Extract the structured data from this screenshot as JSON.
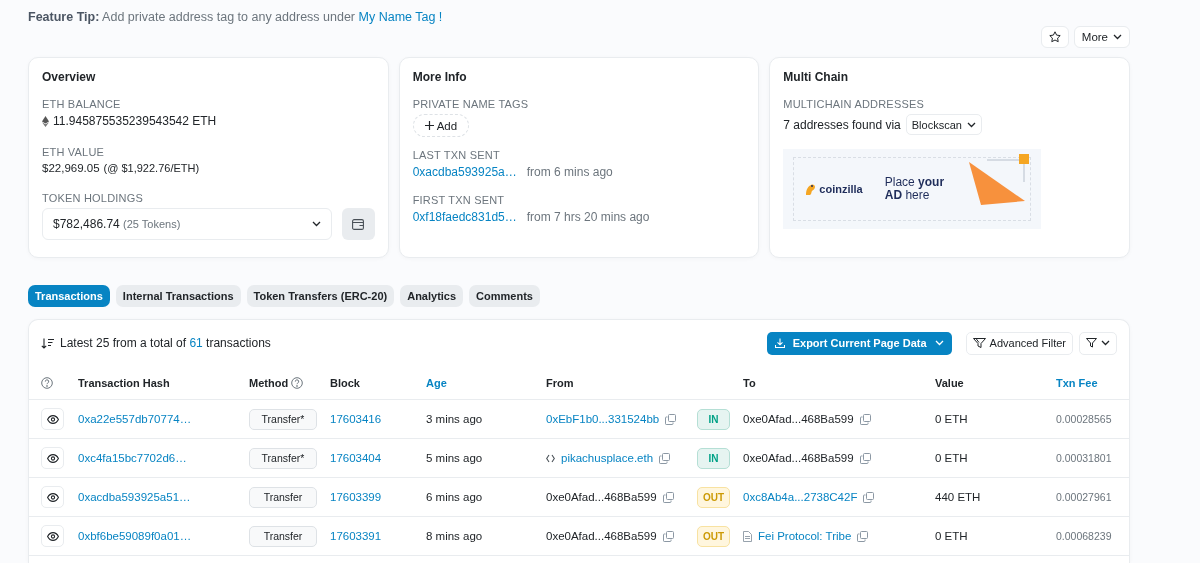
{
  "feature_tip": {
    "label": "Feature Tip:",
    "text": "Add private address tag to any address under",
    "link": "My Name Tag !"
  },
  "actions": {
    "more": "More"
  },
  "overview": {
    "title": "Overview",
    "eth_balance": {
      "label": "ETH BALANCE",
      "value": "11.945875535239543542 ETH"
    },
    "eth_value": {
      "label": "ETH VALUE",
      "value": "$22,969.05",
      "rate": "(@ $1,922.76/ETH)"
    },
    "token_holdings": {
      "label": "TOKEN HOLDINGS",
      "value": "$782,486.74",
      "count": "(25 Tokens)"
    }
  },
  "more_info": {
    "title": "More Info",
    "private_name_tags": {
      "label": "PRIVATE NAME TAGS",
      "button": "Add"
    },
    "last_txn_sent": {
      "label": "LAST TXN SENT",
      "hash": "0xacdba593925a…",
      "age": "from 6 mins ago"
    },
    "first_txn_sent": {
      "label": "FIRST TXN SENT",
      "hash": "0xf18faedc831d5…",
      "age": "from 7 hrs 20 mins ago"
    }
  },
  "multi_chain": {
    "title": "Multi Chain",
    "label": "MULTICHAIN ADDRESSES",
    "text": "7 addresses found via",
    "dropdown": "Blockscan",
    "ad": {
      "brand": "coinzilla",
      "headline": "Place **your**",
      "headline_2": "**AD** here"
    }
  },
  "tabs": [
    {
      "label": "Transactions",
      "selected": true
    },
    {
      "label": "Internal Transactions",
      "selected": false
    },
    {
      "label": "Token Transfers (ERC-20)",
      "selected": false
    },
    {
      "label": "Analytics",
      "selected": false
    },
    {
      "label": "Comments",
      "selected": false
    }
  ],
  "table": {
    "summary": {
      "prefix": "Latest 25 from a total of",
      "total": "61",
      "suffix": "transactions"
    },
    "export_button": "Export Current Page Data",
    "filter_button": "Advanced Filter",
    "columns": [
      {
        "label": "Transaction Hash",
        "link": false,
        "help": false
      },
      {
        "label": "Method",
        "link": false,
        "help": true
      },
      {
        "label": "Block",
        "link": false,
        "help": false
      },
      {
        "label": "Age",
        "link": true,
        "help": false
      },
      {
        "label": "From",
        "link": false,
        "help": false
      },
      {
        "label": "To",
        "link": false,
        "help": false
      },
      {
        "label": "Value",
        "link": false,
        "help": false
      },
      {
        "label": "Txn Fee",
        "link": true,
        "help": false
      }
    ],
    "rows": [
      {
        "hash": "0xa22e557db70774…",
        "method": "Transfer*",
        "block": "17603416",
        "age": "3 mins ago",
        "from": {
          "text": "0xEbF1b0...331524bb",
          "link": true,
          "kind": "address"
        },
        "direction": {
          "label": "IN",
          "kind": "in"
        },
        "to": {
          "text": "0xe0Afad...468Ba599",
          "link": false,
          "kind": "address"
        },
        "value": "0 ETH",
        "fee": "0.00028565"
      },
      {
        "hash": "0xc4fa15bc7702d6…",
        "method": "Transfer*",
        "block": "17603404",
        "age": "5 mins ago",
        "from": {
          "text": "pikachusplace.eth",
          "link": true,
          "kind": "name"
        },
        "direction": {
          "label": "IN",
          "kind": "in"
        },
        "to": {
          "text": "0xe0Afad...468Ba599",
          "link": false,
          "kind": "address"
        },
        "value": "0 ETH",
        "fee": "0.00031801"
      },
      {
        "hash": "0xacdba593925a51…",
        "method": "Transfer",
        "block": "17603399",
        "age": "6 mins ago",
        "from": {
          "text": "0xe0Afad...468Ba599",
          "link": false,
          "kind": "address"
        },
        "direction": {
          "label": "OUT",
          "kind": "out"
        },
        "to": {
          "text": "0xc8Ab4a...2738C42F",
          "link": true,
          "kind": "address"
        },
        "value": "440 ETH",
        "fee": "0.00027961"
      },
      {
        "hash": "0xbf6be59089f0a01…",
        "method": "Transfer",
        "block": "17603391",
        "age": "8 mins ago",
        "from": {
          "text": "0xe0Afad...468Ba599",
          "link": false,
          "kind": "address"
        },
        "direction": {
          "label": "OUT",
          "kind": "out"
        },
        "to": {
          "text": "Fei Protocol: Tribe",
          "link": true,
          "kind": "contract"
        },
        "value": "0 ETH",
        "fee": "0.00068239"
      }
    ]
  }
}
